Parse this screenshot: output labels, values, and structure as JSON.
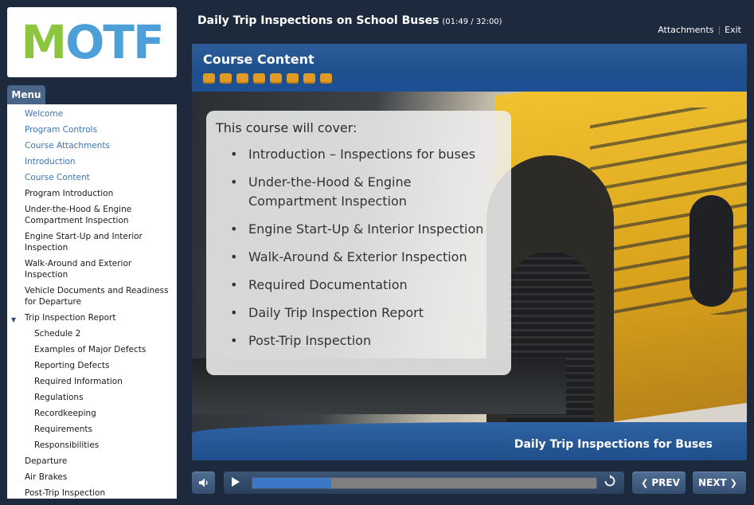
{
  "logo": {
    "text_m": "M",
    "text_otf": "OTF"
  },
  "menu": {
    "tab_label": "Menu",
    "items": [
      {
        "label": "Welcome",
        "state": "visited",
        "level": 0
      },
      {
        "label": "Program Controls",
        "state": "visited",
        "level": 0
      },
      {
        "label": "Course Attachments",
        "state": "visited",
        "level": 0
      },
      {
        "label": "Introduction",
        "state": "visited",
        "level": 0
      },
      {
        "label": "Course Content",
        "state": "visited",
        "level": 0
      },
      {
        "label": "Program Introduction",
        "state": "default",
        "level": 0
      },
      {
        "label": "Under-the-Hood & Engine Compartment Inspection",
        "state": "default",
        "level": 0
      },
      {
        "label": "Engine Start-Up and Interior Inspection",
        "state": "default",
        "level": 0
      },
      {
        "label": "Walk-Around and Exterior Inspection",
        "state": "default",
        "level": 0
      },
      {
        "label": "Vehicle Documents and Readiness for Departure",
        "state": "default",
        "level": 0
      },
      {
        "label": "Trip Inspection Report",
        "state": "expanded",
        "level": 0
      },
      {
        "label": "Schedule 2",
        "state": "default",
        "level": 1
      },
      {
        "label": "Examples of Major Defects",
        "state": "default",
        "level": 1
      },
      {
        "label": "Reporting Defects",
        "state": "default",
        "level": 1
      },
      {
        "label": "Required Information",
        "state": "default",
        "level": 1
      },
      {
        "label": "Regulations",
        "state": "default",
        "level": 1
      },
      {
        "label": "Recordkeeping",
        "state": "default",
        "level": 1
      },
      {
        "label": "Requirements",
        "state": "default",
        "level": 1
      },
      {
        "label": "Responsibilities",
        "state": "default",
        "level": 1
      },
      {
        "label": "Departure",
        "state": "default",
        "level": 0
      },
      {
        "label": "Air Brakes",
        "state": "default",
        "level": 0
      },
      {
        "label": "Post-Trip Inspection",
        "state": "default",
        "level": 0
      }
    ]
  },
  "header": {
    "title": "Daily Trip Inspections on School Buses",
    "time": "(01:49 / 32:00)",
    "attachments_label": "Attachments",
    "separator": "|",
    "exit_label": "Exit"
  },
  "slide": {
    "header_title": "Course Content",
    "progress_dots": 8,
    "card_intro": "This course will cover:",
    "topics": [
      "Introduction – Inspections for buses",
      "Under-the-Hood & Engine Compartment Inspection",
      "Engine Start-Up & Interior Inspection",
      "Walk-Around & Exterior Inspection",
      "Required Documentation",
      "Daily Trip Inspection Report",
      "Post-Trip Inspection"
    ],
    "footer_title": "Daily Trip Inspections for Buses"
  },
  "controls": {
    "mute_icon": "speaker-icon",
    "play_icon": "play-icon",
    "replay_icon": "replay-icon",
    "seek_progress_percent": 23,
    "prev_label": "PREV",
    "next_label": "NEXT"
  },
  "colors": {
    "background": "#1d2a3d",
    "accent_blue": "#3c78c7",
    "progress_orange": "#e09a26",
    "logo_green": "#8cc63f",
    "logo_blue": "#4d9fd8"
  }
}
